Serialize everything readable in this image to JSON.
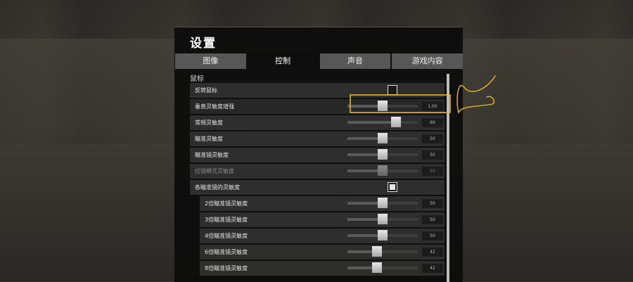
{
  "settings": {
    "title": "设置",
    "tabs": [
      {
        "label": "图像",
        "active": false
      },
      {
        "label": "控制",
        "active": true
      },
      {
        "label": "声音",
        "active": false
      },
      {
        "label": "游戏内容",
        "active": false
      }
    ],
    "section_title": "鼠标",
    "rows": {
      "invert_mouse": {
        "label": "反转鼠标",
        "checked": false
      },
      "vertical_sensitivity": {
        "label": "垂直灵敏度增强",
        "value": "1.00",
        "level": 0.5
      },
      "general_sensitivity": {
        "label": "常规灵敏度",
        "value": "69",
        "level": 0.69
      },
      "aim_sensitivity": {
        "label": "瞄准灵敏度",
        "value": "50",
        "level": 0.5
      },
      "scope_sensitivity": {
        "label": "瞄准镜灵敏度",
        "value": "50",
        "level": 0.5
      },
      "ads_scope_sensitivity": {
        "label": "拉镜模式灵敏度",
        "value": "50",
        "level": 0.5,
        "disabled": true
      },
      "per_scope_sensitivity": {
        "label": "各瞄准镜的灵敏度",
        "checked": true
      },
      "scope_2x": {
        "label": "2倍瞄准镜灵敏度",
        "value": "50",
        "level": 0.5
      },
      "scope_3x": {
        "label": "3倍瞄准镜灵敏度",
        "value": "50",
        "level": 0.5
      },
      "scope_4x": {
        "label": "4倍瞄准镜灵敏度",
        "value": "50",
        "level": 0.5
      },
      "scope_6x": {
        "label": "6倍瞄准镜灵敏度",
        "value": "42",
        "level": 0.42
      },
      "scope_8x": {
        "label": "8倍瞄准镜灵敏度",
        "value": "42",
        "level": 0.42
      }
    }
  },
  "colors": {
    "highlight_annotation": "#e8b42a",
    "active_tab": "#0e0e0e",
    "inactive_tab": "#575757"
  }
}
